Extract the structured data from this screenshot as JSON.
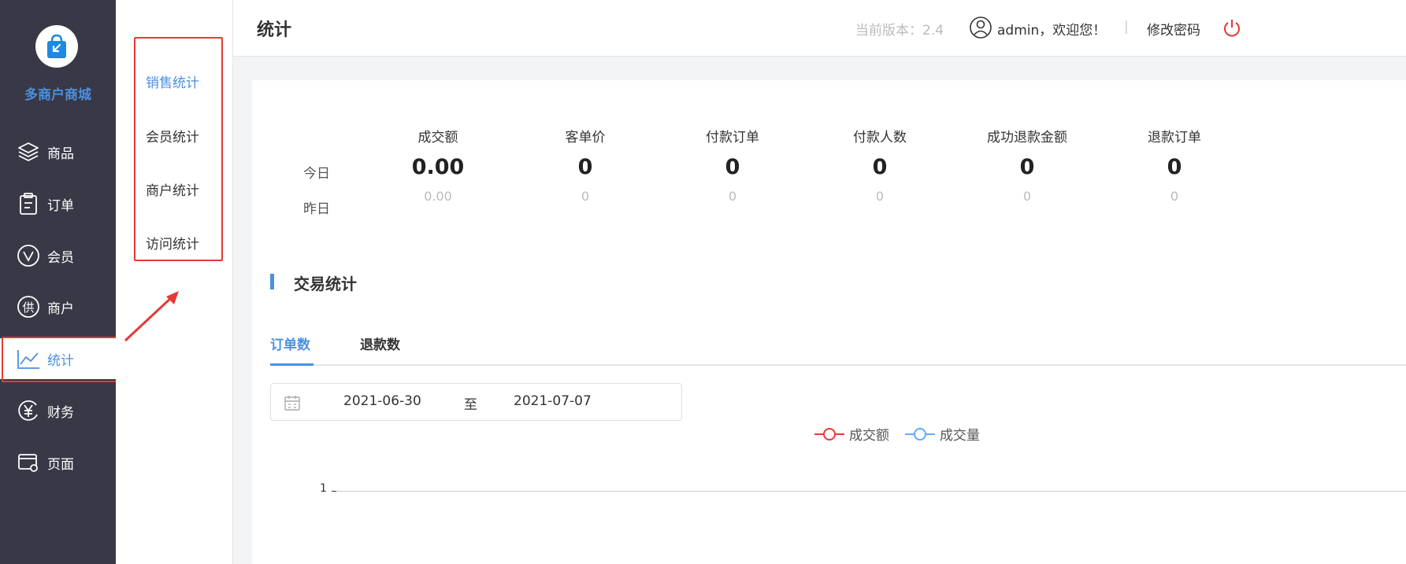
{
  "sidebar": {
    "brand": "多商户商城",
    "items": [
      {
        "label": "商品",
        "icon": "layers-icon"
      },
      {
        "label": "订单",
        "icon": "clipboard-icon"
      },
      {
        "label": "会员",
        "icon": "vip-icon"
      },
      {
        "label": "商户",
        "icon": "supplier-icon"
      },
      {
        "label": "统计",
        "icon": "line-chart-icon",
        "active": true
      },
      {
        "label": "财务",
        "icon": "yuan-icon"
      },
      {
        "label": "页面",
        "icon": "page-settings-icon"
      }
    ]
  },
  "submenu": {
    "items": [
      {
        "label": "销售统计",
        "active": true
      },
      {
        "label": "会员统计"
      },
      {
        "label": "商户统计"
      },
      {
        "label": "访问统计"
      }
    ]
  },
  "header": {
    "title": "统计",
    "version": "当前版本：2.4",
    "welcome": "admin，欢迎您！",
    "divider": "|",
    "change_password": "修改密码"
  },
  "stats": {
    "row_today": "今日",
    "row_yesterday": "昨日",
    "columns": [
      {
        "header": "成交额",
        "today": "0.00",
        "yesterday": "0.00"
      },
      {
        "header": "客单价",
        "today": "0",
        "yesterday": "0"
      },
      {
        "header": "付款订单",
        "today": "0",
        "yesterday": "0"
      },
      {
        "header": "付款人数",
        "today": "0",
        "yesterday": "0"
      },
      {
        "header": "成功退款金额",
        "today": "0",
        "yesterday": "0"
      },
      {
        "header": "退款订单",
        "today": "0",
        "yesterday": "0"
      }
    ]
  },
  "trade": {
    "title": "交易统计",
    "tabs": [
      {
        "label": "订单数",
        "active": true
      },
      {
        "label": "退款数"
      }
    ],
    "date_start": "2021-06-30",
    "date_sep": "至",
    "date_end": "2021-07-07"
  },
  "chart_data": {
    "type": "line",
    "series": [
      {
        "name": "成交额",
        "color": "#e53935"
      },
      {
        "name": "成交量",
        "color": "#64a8f5"
      }
    ],
    "y_ticks": [
      "1"
    ]
  },
  "colors": {
    "accent": "#4a90e2",
    "sidebar_bg": "#393847",
    "highlight_border": "#e53935"
  }
}
